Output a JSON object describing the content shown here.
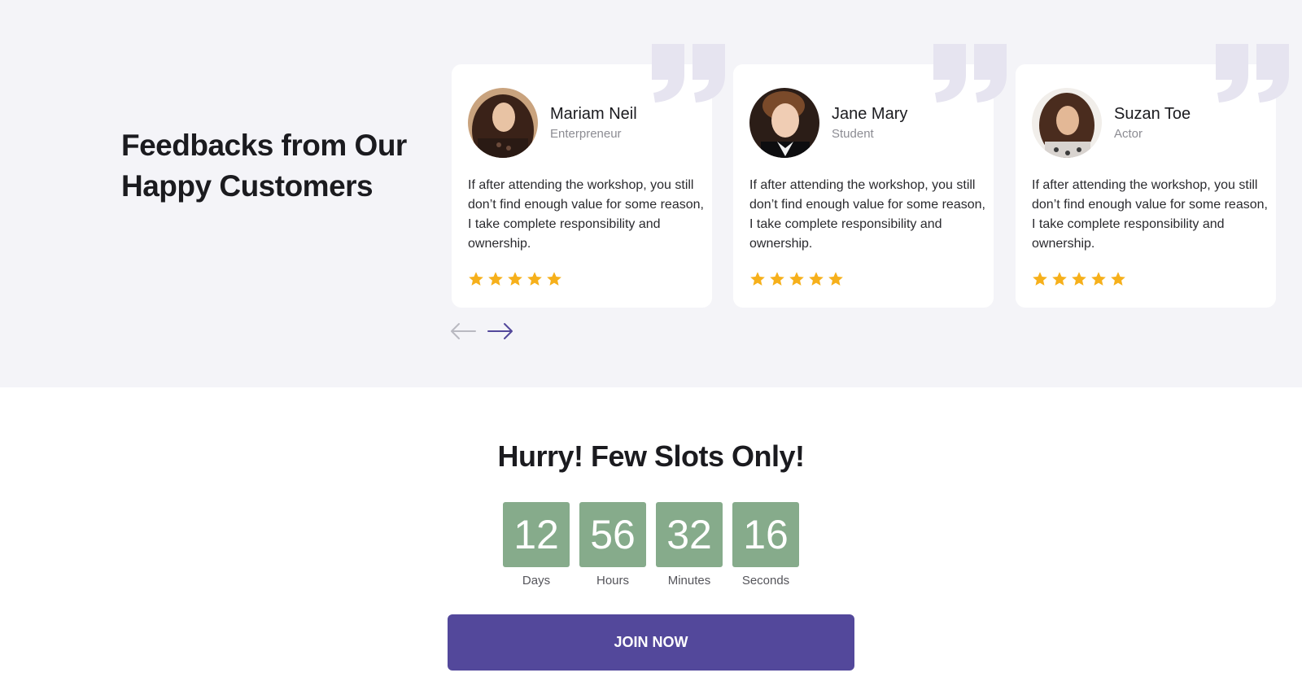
{
  "testimonials": {
    "heading": "Feedbacks from Our Happy Customers",
    "cards": [
      {
        "name": "Mariam Neil",
        "role": "Enterpreneur",
        "text": "If after attending the workshop, you still don’t find enough value for some reason, I take complete responsibility and ownership.",
        "rating": 5
      },
      {
        "name": "Jane Mary",
        "role": "Student",
        "text": "If after attending the workshop, you still don’t find enough value for some reason, I take complete responsibility and ownership.",
        "rating": 5
      },
      {
        "name": "Suzan Toe",
        "role": "Actor",
        "text": "If after attending the workshop, you still don’t find enough value for some reason, I take complete responsibility and ownership.",
        "rating": 5
      }
    ],
    "nav": {
      "prev_icon": "arrow-left-icon",
      "next_icon": "arrow-right-icon"
    }
  },
  "cta": {
    "title": "Hurry! Few Slots Only!",
    "countdown": [
      {
        "value": "12",
        "label": "Days"
      },
      {
        "value": "56",
        "label": "Hours"
      },
      {
        "value": "32",
        "label": "Minutes"
      },
      {
        "value": "16",
        "label": "Seconds"
      }
    ],
    "button_label": "JOIN NOW"
  },
  "colors": {
    "section_bg": "#f4f4f8",
    "accent": "#53489b",
    "countdown_box": "#86ab8b",
    "star": "#f6b01b",
    "quote_mark": "#e6e4f0"
  }
}
